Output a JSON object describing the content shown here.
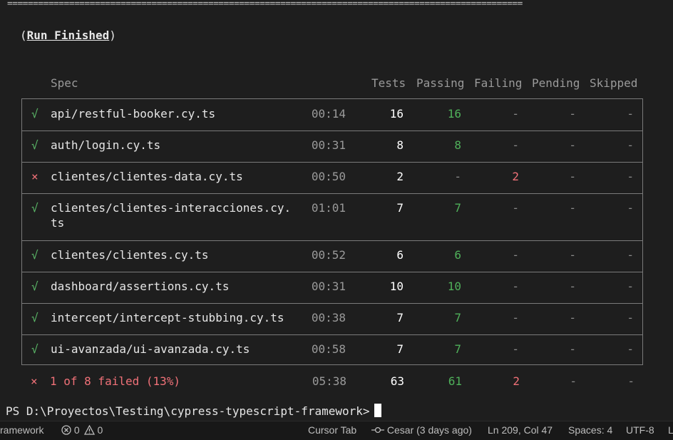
{
  "rule": "====================================================================================================",
  "run_finished": {
    "open": "(",
    "label": "Run Finished",
    "close": ")"
  },
  "headers": {
    "spec": "Spec",
    "tests": "Tests",
    "passing": "Passing",
    "failing": "Failing",
    "pending": "Pending",
    "skipped": "Skipped"
  },
  "rows": [
    {
      "status": "pass",
      "icon": "√",
      "spec": "api/restful-booker.cy.ts",
      "spec2": "",
      "time": "00:14",
      "tests": "16",
      "passing": "16",
      "failing": "-",
      "pending": "-",
      "skipped": "-"
    },
    {
      "status": "pass",
      "icon": "√",
      "spec": "auth/login.cy.ts",
      "spec2": "",
      "time": "00:31",
      "tests": "8",
      "passing": "8",
      "failing": "-",
      "pending": "-",
      "skipped": "-"
    },
    {
      "status": "fail",
      "icon": "×",
      "spec": "clientes/clientes-data.cy.ts",
      "spec2": "",
      "time": "00:50",
      "tests": "2",
      "passing": "-",
      "failing": "2",
      "pending": "-",
      "skipped": "-"
    },
    {
      "status": "pass",
      "icon": "√",
      "spec": "clientes/clientes-interacciones.cy.",
      "spec2": "ts",
      "time": "01:01",
      "tests": "7",
      "passing": "7",
      "failing": "-",
      "pending": "-",
      "skipped": "-"
    },
    {
      "status": "pass",
      "icon": "√",
      "spec": "clientes/clientes.cy.ts",
      "spec2": "",
      "time": "00:52",
      "tests": "6",
      "passing": "6",
      "failing": "-",
      "pending": "-",
      "skipped": "-"
    },
    {
      "status": "pass",
      "icon": "√",
      "spec": "dashboard/assertions.cy.ts",
      "spec2": "",
      "time": "00:31",
      "tests": "10",
      "passing": "10",
      "failing": "-",
      "pending": "-",
      "skipped": "-"
    },
    {
      "status": "pass",
      "icon": "√",
      "spec": "intercept/intercept-stubbing.cy.ts",
      "spec2": "",
      "time": "00:38",
      "tests": "7",
      "passing": "7",
      "failing": "-",
      "pending": "-",
      "skipped": "-"
    },
    {
      "status": "pass",
      "icon": "√",
      "spec": "ui-avanzada/ui-avanzada.cy.ts",
      "spec2": "",
      "time": "00:58",
      "tests": "7",
      "passing": "7",
      "failing": "-",
      "pending": "-",
      "skipped": "-"
    }
  ],
  "summary": {
    "icon": "×",
    "text": "1 of 8 failed (13%)",
    "time": "05:38",
    "tests": "63",
    "passing": "61",
    "failing": "2",
    "pending": "-",
    "skipped": "-"
  },
  "prompt": "PS D:\\Proyectos\\Testing\\cypress-typescript-framework>",
  "statusbar": {
    "left": "ramework",
    "errors": "0",
    "warnings": "0",
    "cursor_tab": "Cursor Tab",
    "git_blame": "Cesar (3 days ago)",
    "position": "Ln 209, Col 47",
    "spaces": "Spaces: 4",
    "encoding": "UTF-8",
    "eol": "L"
  },
  "colors": {
    "pass": "#5bb868",
    "fail": "#f07178",
    "background": "#1e1e1e"
  }
}
